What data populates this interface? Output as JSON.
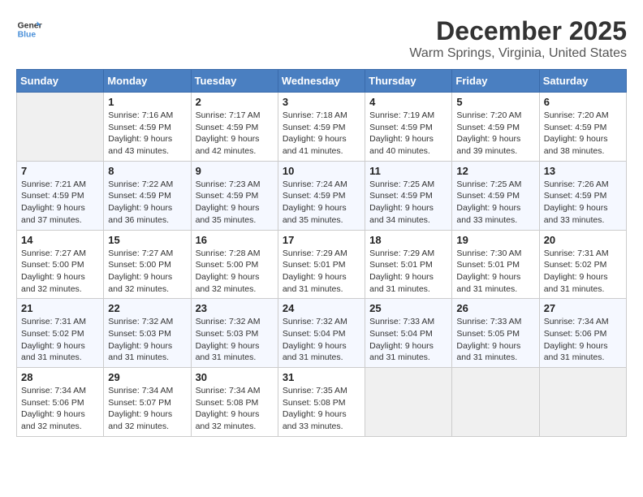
{
  "header": {
    "logo_line1": "General",
    "logo_line2": "Blue",
    "month": "December 2025",
    "location": "Warm Springs, Virginia, United States"
  },
  "weekdays": [
    "Sunday",
    "Monday",
    "Tuesday",
    "Wednesday",
    "Thursday",
    "Friday",
    "Saturday"
  ],
  "weeks": [
    [
      {
        "day": "",
        "sunrise": "",
        "sunset": "",
        "daylight": ""
      },
      {
        "day": "1",
        "sunrise": "Sunrise: 7:16 AM",
        "sunset": "Sunset: 4:59 PM",
        "daylight": "Daylight: 9 hours and 43 minutes."
      },
      {
        "day": "2",
        "sunrise": "Sunrise: 7:17 AM",
        "sunset": "Sunset: 4:59 PM",
        "daylight": "Daylight: 9 hours and 42 minutes."
      },
      {
        "day": "3",
        "sunrise": "Sunrise: 7:18 AM",
        "sunset": "Sunset: 4:59 PM",
        "daylight": "Daylight: 9 hours and 41 minutes."
      },
      {
        "day": "4",
        "sunrise": "Sunrise: 7:19 AM",
        "sunset": "Sunset: 4:59 PM",
        "daylight": "Daylight: 9 hours and 40 minutes."
      },
      {
        "day": "5",
        "sunrise": "Sunrise: 7:20 AM",
        "sunset": "Sunset: 4:59 PM",
        "daylight": "Daylight: 9 hours and 39 minutes."
      },
      {
        "day": "6",
        "sunrise": "Sunrise: 7:20 AM",
        "sunset": "Sunset: 4:59 PM",
        "daylight": "Daylight: 9 hours and 38 minutes."
      }
    ],
    [
      {
        "day": "7",
        "sunrise": "Sunrise: 7:21 AM",
        "sunset": "Sunset: 4:59 PM",
        "daylight": "Daylight: 9 hours and 37 minutes."
      },
      {
        "day": "8",
        "sunrise": "Sunrise: 7:22 AM",
        "sunset": "Sunset: 4:59 PM",
        "daylight": "Daylight: 9 hours and 36 minutes."
      },
      {
        "day": "9",
        "sunrise": "Sunrise: 7:23 AM",
        "sunset": "Sunset: 4:59 PM",
        "daylight": "Daylight: 9 hours and 35 minutes."
      },
      {
        "day": "10",
        "sunrise": "Sunrise: 7:24 AM",
        "sunset": "Sunset: 4:59 PM",
        "daylight": "Daylight: 9 hours and 35 minutes."
      },
      {
        "day": "11",
        "sunrise": "Sunrise: 7:25 AM",
        "sunset": "Sunset: 4:59 PM",
        "daylight": "Daylight: 9 hours and 34 minutes."
      },
      {
        "day": "12",
        "sunrise": "Sunrise: 7:25 AM",
        "sunset": "Sunset: 4:59 PM",
        "daylight": "Daylight: 9 hours and 33 minutes."
      },
      {
        "day": "13",
        "sunrise": "Sunrise: 7:26 AM",
        "sunset": "Sunset: 4:59 PM",
        "daylight": "Daylight: 9 hours and 33 minutes."
      }
    ],
    [
      {
        "day": "14",
        "sunrise": "Sunrise: 7:27 AM",
        "sunset": "Sunset: 5:00 PM",
        "daylight": "Daylight: 9 hours and 32 minutes."
      },
      {
        "day": "15",
        "sunrise": "Sunrise: 7:27 AM",
        "sunset": "Sunset: 5:00 PM",
        "daylight": "Daylight: 9 hours and 32 minutes."
      },
      {
        "day": "16",
        "sunrise": "Sunrise: 7:28 AM",
        "sunset": "Sunset: 5:00 PM",
        "daylight": "Daylight: 9 hours and 32 minutes."
      },
      {
        "day": "17",
        "sunrise": "Sunrise: 7:29 AM",
        "sunset": "Sunset: 5:01 PM",
        "daylight": "Daylight: 9 hours and 31 minutes."
      },
      {
        "day": "18",
        "sunrise": "Sunrise: 7:29 AM",
        "sunset": "Sunset: 5:01 PM",
        "daylight": "Daylight: 9 hours and 31 minutes."
      },
      {
        "day": "19",
        "sunrise": "Sunrise: 7:30 AM",
        "sunset": "Sunset: 5:01 PM",
        "daylight": "Daylight: 9 hours and 31 minutes."
      },
      {
        "day": "20",
        "sunrise": "Sunrise: 7:31 AM",
        "sunset": "Sunset: 5:02 PM",
        "daylight": "Daylight: 9 hours and 31 minutes."
      }
    ],
    [
      {
        "day": "21",
        "sunrise": "Sunrise: 7:31 AM",
        "sunset": "Sunset: 5:02 PM",
        "daylight": "Daylight: 9 hours and 31 minutes."
      },
      {
        "day": "22",
        "sunrise": "Sunrise: 7:32 AM",
        "sunset": "Sunset: 5:03 PM",
        "daylight": "Daylight: 9 hours and 31 minutes."
      },
      {
        "day": "23",
        "sunrise": "Sunrise: 7:32 AM",
        "sunset": "Sunset: 5:03 PM",
        "daylight": "Daylight: 9 hours and 31 minutes."
      },
      {
        "day": "24",
        "sunrise": "Sunrise: 7:32 AM",
        "sunset": "Sunset: 5:04 PM",
        "daylight": "Daylight: 9 hours and 31 minutes."
      },
      {
        "day": "25",
        "sunrise": "Sunrise: 7:33 AM",
        "sunset": "Sunset: 5:04 PM",
        "daylight": "Daylight: 9 hours and 31 minutes."
      },
      {
        "day": "26",
        "sunrise": "Sunrise: 7:33 AM",
        "sunset": "Sunset: 5:05 PM",
        "daylight": "Daylight: 9 hours and 31 minutes."
      },
      {
        "day": "27",
        "sunrise": "Sunrise: 7:34 AM",
        "sunset": "Sunset: 5:06 PM",
        "daylight": "Daylight: 9 hours and 31 minutes."
      }
    ],
    [
      {
        "day": "28",
        "sunrise": "Sunrise: 7:34 AM",
        "sunset": "Sunset: 5:06 PM",
        "daylight": "Daylight: 9 hours and 32 minutes."
      },
      {
        "day": "29",
        "sunrise": "Sunrise: 7:34 AM",
        "sunset": "Sunset: 5:07 PM",
        "daylight": "Daylight: 9 hours and 32 minutes."
      },
      {
        "day": "30",
        "sunrise": "Sunrise: 7:34 AM",
        "sunset": "Sunset: 5:08 PM",
        "daylight": "Daylight: 9 hours and 32 minutes."
      },
      {
        "day": "31",
        "sunrise": "Sunrise: 7:35 AM",
        "sunset": "Sunset: 5:08 PM",
        "daylight": "Daylight: 9 hours and 33 minutes."
      },
      {
        "day": "",
        "sunrise": "",
        "sunset": "",
        "daylight": ""
      },
      {
        "day": "",
        "sunrise": "",
        "sunset": "",
        "daylight": ""
      },
      {
        "day": "",
        "sunrise": "",
        "sunset": "",
        "daylight": ""
      }
    ]
  ]
}
